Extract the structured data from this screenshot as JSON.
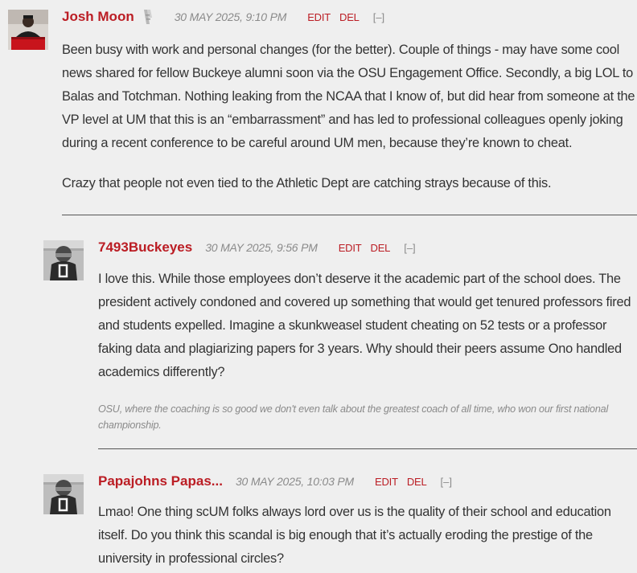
{
  "comments": [
    {
      "username": "Josh Moon",
      "timestamp": "30 MAY 2025, 9:10 PM",
      "edit": "EDIT",
      "del": "DEL",
      "collapse": "[–]",
      "paragraphs": [
        "Been busy with work and personal changes (for the better).  Couple of things - may have some cool news shared for fellow Buckeye alumni soon via the OSU Engagement Office.  Secondly, a big LOL to Balas and Totchman.  Nothing leaking from the NCAA that I know of, but did hear from someone at the VP level at UM that this is an “embarrassment” and has led to professional colleagues openly joking during a recent conference to be careful around UM men, because they’re known to cheat.",
        "Crazy that people not even tied to the Athletic Dept are catching strays because of this."
      ]
    },
    {
      "username": "7493Buckeyes",
      "timestamp": "30 MAY 2025, 9:56 PM",
      "edit": "EDIT",
      "del": "DEL",
      "collapse": "[–]",
      "paragraphs": [
        "I love this. While those employees don’t deserve it the academic part of the school does. The president actively condoned and covered up something that would get tenured professors fired and students expelled. Imagine a skunkweasel student cheating on 52 tests or a professor faking data and plagiarizing papers for 3 years. Why should their peers assume Ono handled academics differently?"
      ],
      "signature": "OSU, where the coaching is so good we don't even talk about the greatest coach of all time, who won our first national championship."
    },
    {
      "username": "Papajohns Papas...",
      "timestamp": "30 MAY 2025, 10:03 PM",
      "edit": "EDIT",
      "del": "DEL",
      "collapse": "[–]",
      "paragraphs": [
        "Lmao! One thing scUM folks always lord over us is the quality of their school and education itself. Do you think this scandal is big enough that it’s actually eroding the prestige of the university in professional circles?"
      ]
    }
  ],
  "colors": {
    "accent": "#bb1d24",
    "muted": "#8a8a8a",
    "text": "#333333",
    "background": "#efefef"
  }
}
